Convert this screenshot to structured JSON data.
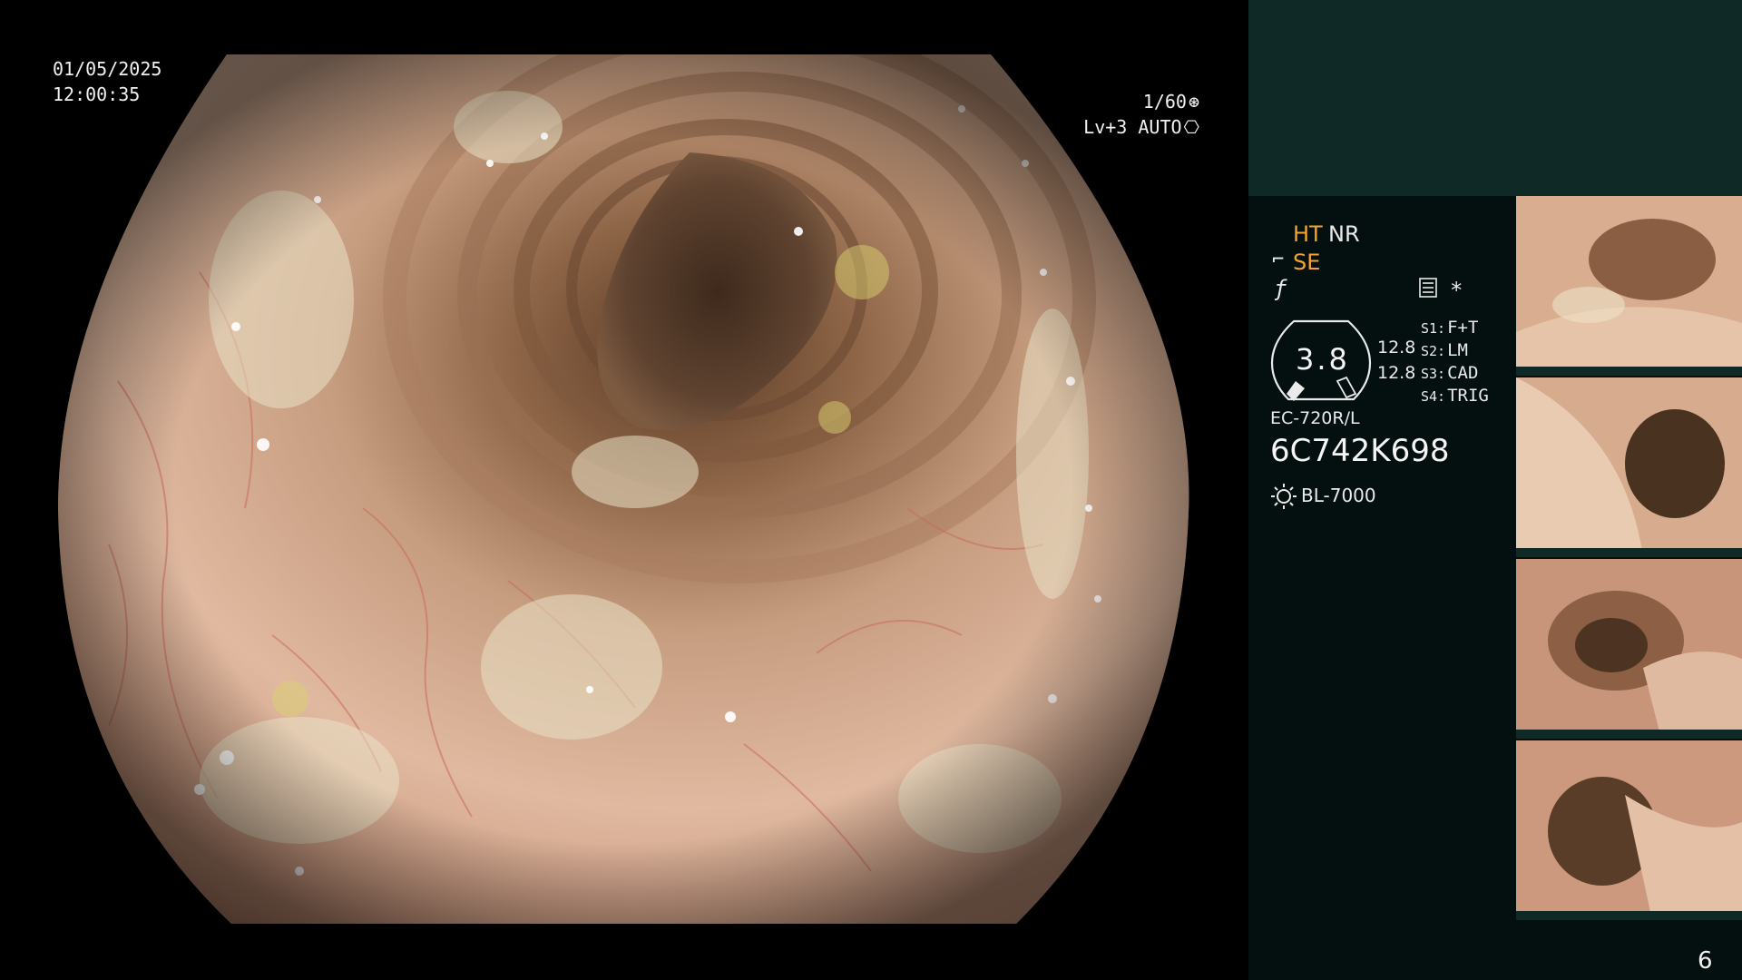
{
  "overlay": {
    "date": "01/05/2025",
    "time": "12:00:35",
    "shutter": "1/60",
    "exposure": "Lv+3 AUTO"
  },
  "panel": {
    "mode_ht": "HT",
    "mode_nr": "NR",
    "mode_se": "SE",
    "star": "*",
    "gauge_value": "3.8",
    "gauge_sub1": "12.8",
    "gauge_sub2": "12.8",
    "switches": [
      {
        "key": "S1:",
        "value": "F+T"
      },
      {
        "key": "S2:",
        "value": "LM"
      },
      {
        "key": "S3:",
        "value": "CAD"
      },
      {
        "key": "S4:",
        "value": "TRIG"
      }
    ],
    "scope_model": "EC-720R/L",
    "serial": "6C742K698",
    "light_source": "BL-7000",
    "page_number": "6"
  },
  "colors": {
    "accent": "#f3a42c",
    "panel_bg": "#03100f",
    "panel_header": "#0f2a26"
  },
  "icons": [
    "shutter-icon",
    "auto-iris-icon",
    "scope-icon",
    "filter-icon",
    "menu-icon",
    "light-source-icon"
  ]
}
